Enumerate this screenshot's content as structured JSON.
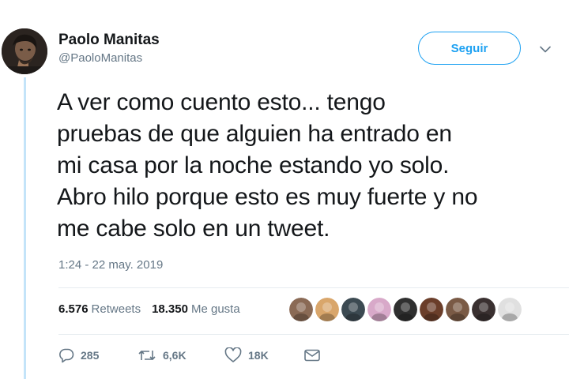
{
  "user": {
    "display_name": "Paolo Manitas",
    "handle": "@PaoloManitas"
  },
  "follow_button": {
    "label": "Seguir"
  },
  "tweet": {
    "lines": [
      "A ver como cuento esto... tengo",
      "pruebas de que alguien ha entrado en",
      "mi casa por la noche estando yo solo.",
      "Abro hilo porque esto es muy fuerte y no",
      "me cabe solo en un tweet."
    ],
    "timestamp": "1:24 - 22 may. 2019"
  },
  "stats": {
    "retweets_count": "6.576",
    "retweets_label": "Retweets",
    "likes_count": "18.350",
    "likes_label": "Me gusta"
  },
  "liked_by_avatars": [
    {
      "color": "#8a6a55"
    },
    {
      "color": "#d9a66b"
    },
    {
      "color": "#3c4a52"
    },
    {
      "color": "#d8a9c9"
    },
    {
      "color": "#2f2f2f"
    },
    {
      "color": "#6b3e2a"
    },
    {
      "color": "#7a5a45"
    },
    {
      "color": "#3a3030"
    },
    {
      "color": "#e0e0e0"
    }
  ],
  "actions": {
    "replies": "285",
    "retweets": "6,6K",
    "likes": "18K"
  },
  "colors": {
    "accent": "#1da1f2",
    "secondary_text": "#657786",
    "thread_line": "#c4e4f9"
  },
  "icons": {
    "caret": "chevron-down-icon",
    "reply": "reply-icon",
    "retweet": "retweet-icon",
    "like": "heart-icon",
    "dm": "envelope-icon"
  }
}
